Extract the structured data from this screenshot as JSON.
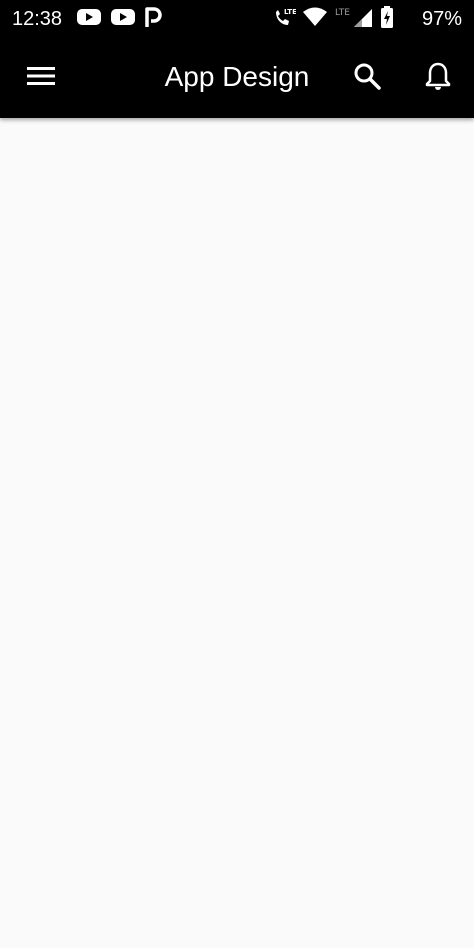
{
  "status_bar": {
    "time": "12:38",
    "battery_percent": "97%",
    "left_icons": [
      "youtube-icon",
      "youtube-icon",
      "p-app-icon"
    ],
    "right_icons": [
      "lte-call-icon",
      "wifi-icon",
      "lte-signal-icon",
      "battery-icon"
    ]
  },
  "app_bar": {
    "title": "App Design",
    "menu_icon": "menu-icon",
    "search_icon": "search-icon",
    "notification_icon": "bell-icon"
  },
  "colors": {
    "app_bar_bg": "#000000",
    "content_bg": "#fafafa",
    "text_on_dark": "#ffffff"
  }
}
